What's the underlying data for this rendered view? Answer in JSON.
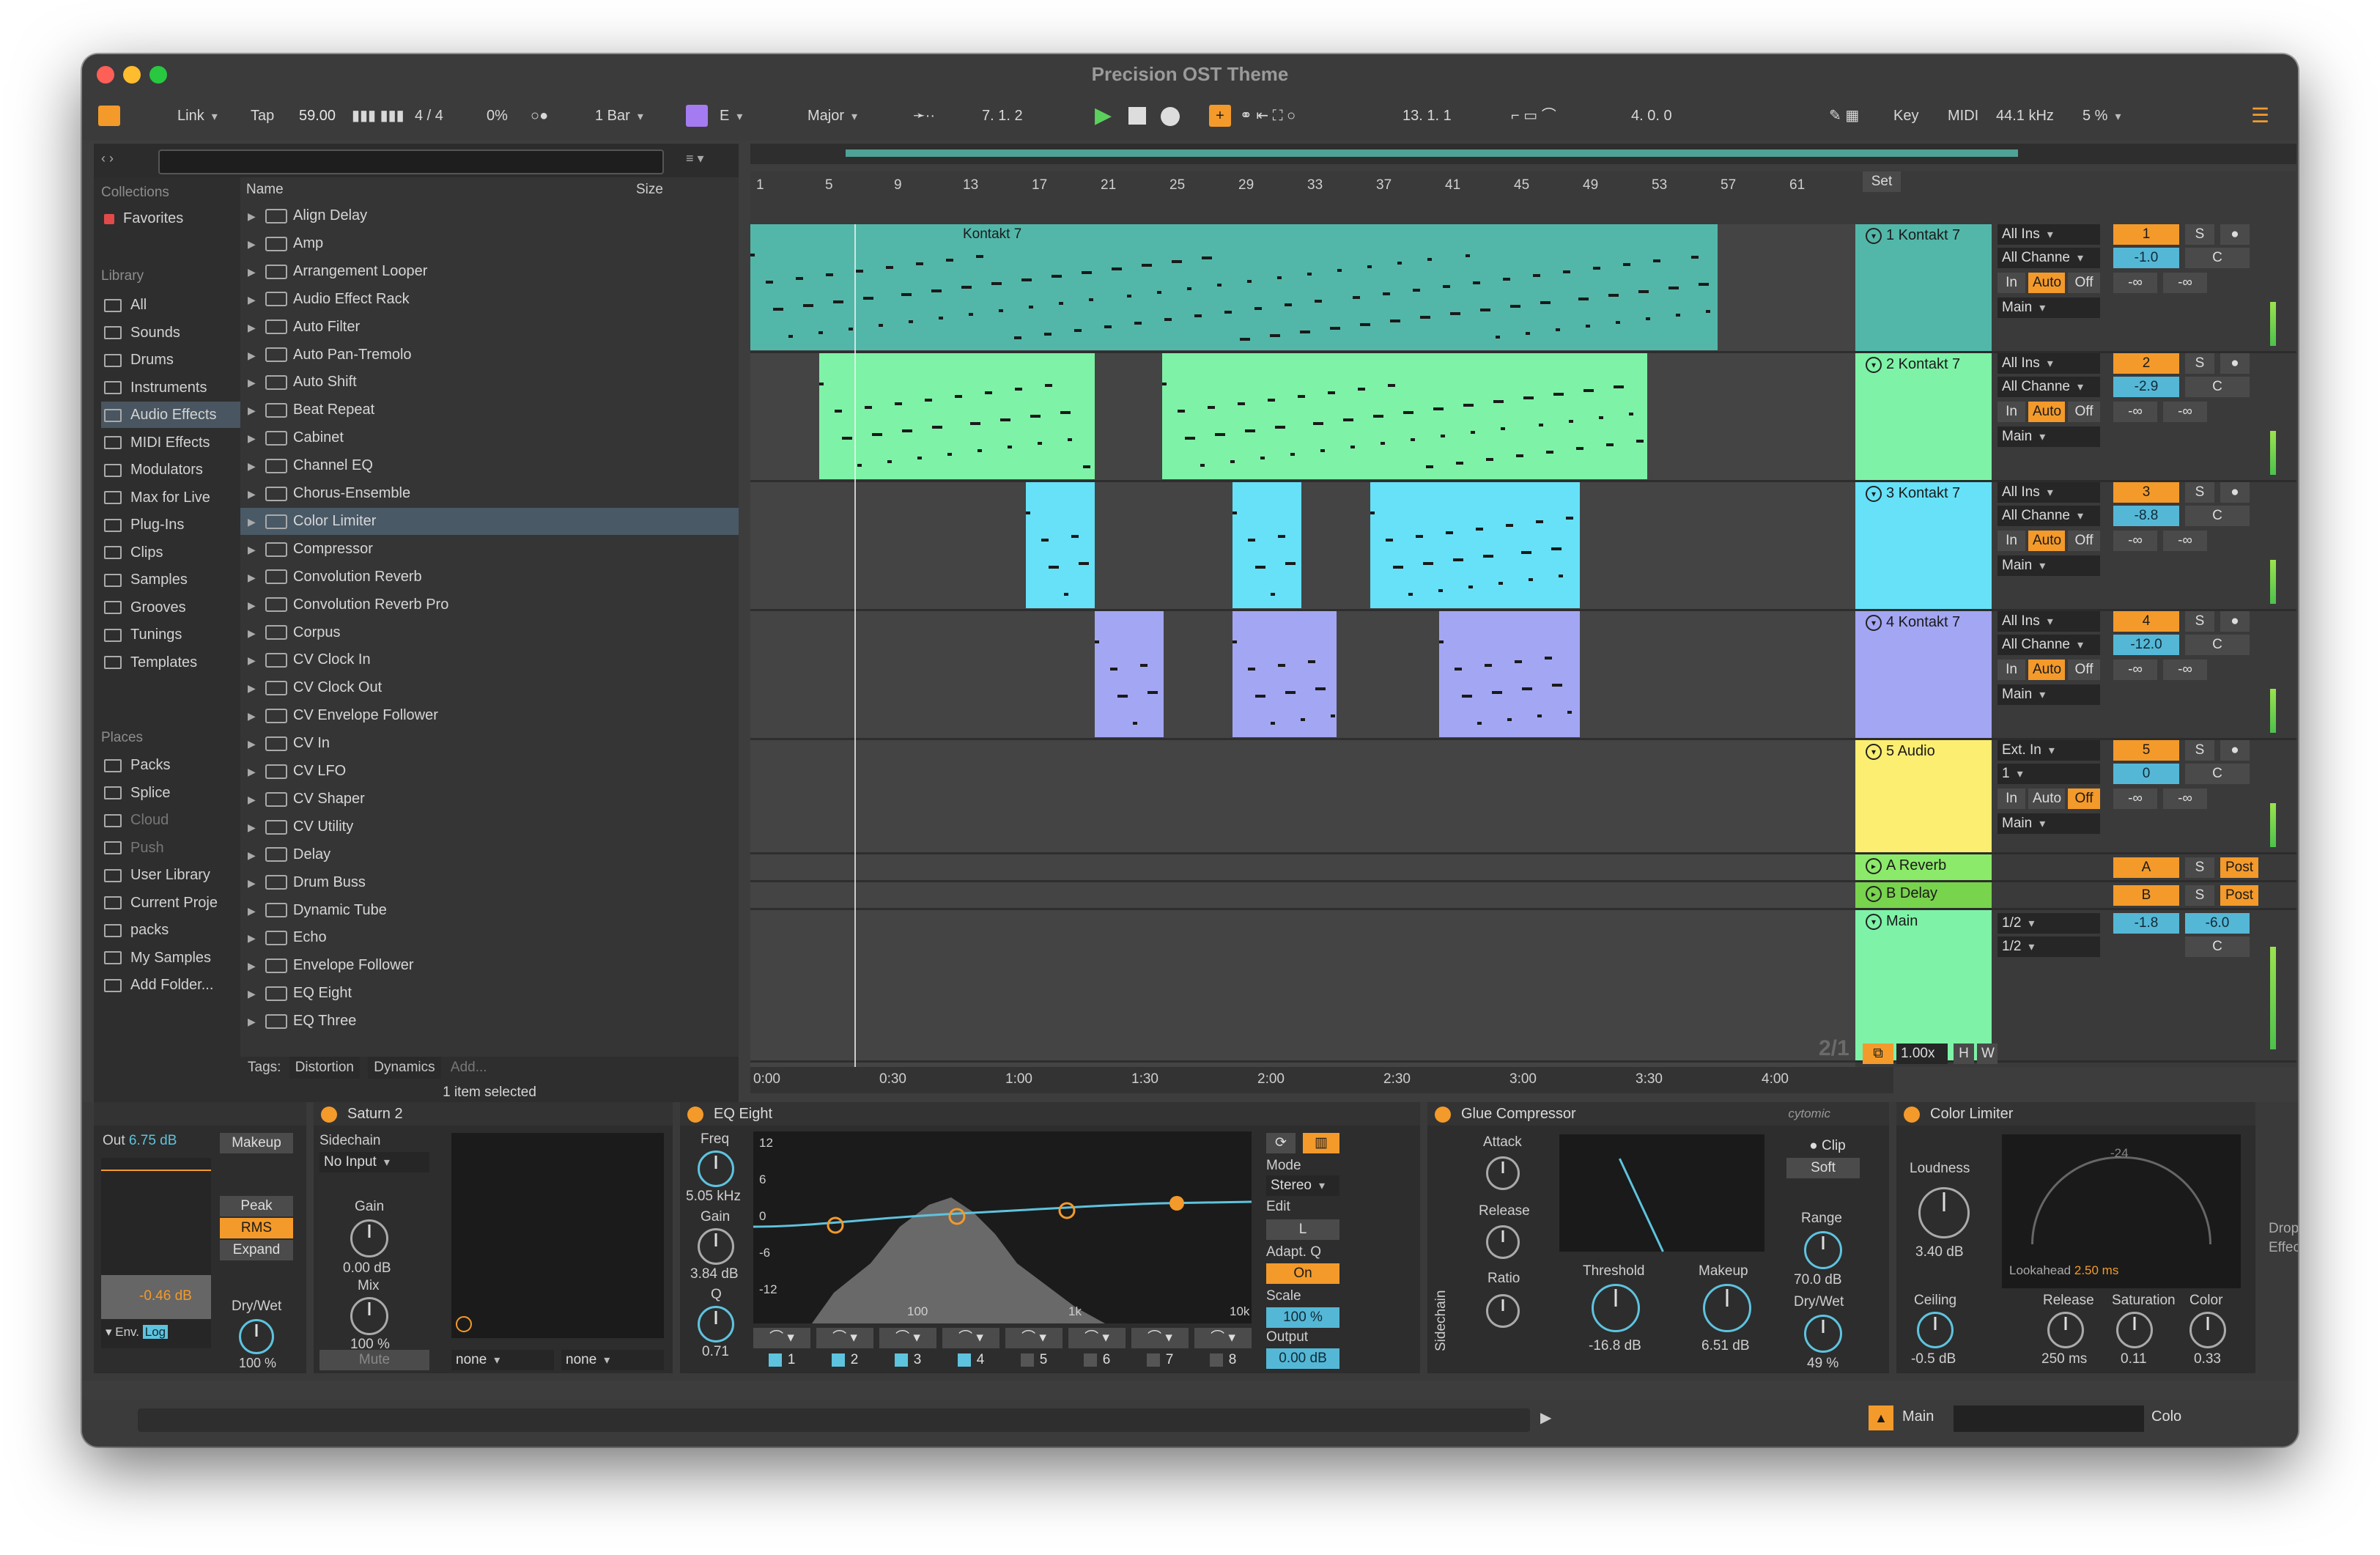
{
  "window": {
    "title": "Precision OST Theme"
  },
  "control_bar": {
    "link": "Link",
    "tap": "Tap",
    "tempo": "59.00",
    "signature": "4 / 4",
    "groove": "0%",
    "quantize": "1 Bar",
    "key_root": "E",
    "key_scale": "Major",
    "position": "7.  1.  2",
    "loop_start": "13.  1.  1",
    "loop_length": "4.  0.  0",
    "key_label": "Key",
    "midi_label": "MIDI",
    "sample_rate": "44.1 kHz",
    "cpu": "5 %"
  },
  "browser": {
    "collections_label": "Collections",
    "favorites": "Favorites",
    "library_label": "Library",
    "library": [
      "All",
      "Sounds",
      "Drums",
      "Instruments",
      "Audio Effects",
      "MIDI Effects",
      "Modulators",
      "Max for Live",
      "Plug-Ins",
      "Clips",
      "Samples",
      "Grooves",
      "Tunings",
      "Templates"
    ],
    "selected_library": "Audio Effects",
    "places_label": "Places",
    "places": [
      "Packs",
      "Splice",
      "Cloud",
      "Push",
      "User Library",
      "Current Proje",
      "packs",
      "My Samples",
      "Add Folder..."
    ],
    "col_name": "Name",
    "col_size": "Size",
    "files": [
      "Align Delay",
      "Amp",
      "Arrangement Looper",
      "Audio Effect Rack",
      "Auto Filter",
      "Auto Pan-Tremolo",
      "Auto Shift",
      "Beat Repeat",
      "Cabinet",
      "Channel EQ",
      "Chorus-Ensemble",
      "Color Limiter",
      "Compressor",
      "Convolution Reverb",
      "Convolution Reverb Pro",
      "Corpus",
      "CV Clock In",
      "CV Clock Out",
      "CV Envelope Follower",
      "CV In",
      "CV LFO",
      "CV Shaper",
      "CV Utility",
      "Delay",
      "Drum Buss",
      "Dynamic Tube",
      "Echo",
      "Envelope Follower",
      "EQ Eight",
      "EQ Three"
    ],
    "selected_file": "Color Limiter",
    "tags_label": "Tags:",
    "tags": [
      "Distortion",
      "Dynamics"
    ],
    "tags_add": "Add...",
    "status": "1 item selected"
  },
  "arrangement": {
    "bars": [
      "1",
      "5",
      "9",
      "13",
      "17",
      "21",
      "25",
      "29",
      "33",
      "37",
      "41",
      "45",
      "49",
      "53",
      "57",
      "61"
    ],
    "times": [
      "0:00",
      "0:30",
      "1:00",
      "1:30",
      "2:00",
      "2:30",
      "3:00",
      "3:30",
      "4:00"
    ],
    "page": "2/1",
    "clip_label": "Kontakt 7",
    "zoom": "1.00x",
    "h_btn": "H",
    "w_btn": "W",
    "set_btn": "Set"
  },
  "tracks": [
    {
      "name": "1 Kontakt 7",
      "color": "#52b7a9",
      "input": "All Ins",
      "channel": "All Channe",
      "num": "1",
      "vol": "-1.0",
      "pan": "C",
      "out": "Main"
    },
    {
      "name": "2 Kontakt 7",
      "color": "#7ef2a7",
      "input": "All Ins",
      "channel": "All Channe",
      "num": "2",
      "vol": "-2.9",
      "pan": "C",
      "out": "Main"
    },
    {
      "name": "3 Kontakt 7",
      "color": "#66e1f8",
      "input": "All Ins",
      "channel": "All Channe",
      "num": "3",
      "vol": "-8.8",
      "pan": "C",
      "out": "Main"
    },
    {
      "name": "4 Kontakt 7",
      "color": "#a3a6f2",
      "input": "All Ins",
      "channel": "All Channe",
      "num": "4",
      "vol": "-12.0",
      "pan": "C",
      "out": "Main"
    },
    {
      "name": "5 Audio",
      "color": "#fbee71",
      "input": "Ext. In",
      "channel": "1",
      "num": "5",
      "vol": "0",
      "pan": "C",
      "out": "Main"
    }
  ],
  "returns": [
    {
      "name": "A Reverb",
      "color": "#8cea6a",
      "num": "A",
      "post": "Post"
    },
    {
      "name": "B Delay",
      "color": "#78d34d",
      "num": "B",
      "post": "Post"
    }
  ],
  "main": {
    "name": "Main",
    "color": "#7ef2a7",
    "in1": "1/2",
    "in2": "1/2",
    "vol": "-1.8",
    "vol2": "-6.0",
    "pan": "C"
  },
  "mixer_labels": {
    "in": "In",
    "auto": "Auto",
    "off": "Off",
    "solo": "S",
    "neg_inf": "-∞"
  },
  "devices": {
    "utility": {
      "out": "Out",
      "out_val": "6.75 dB",
      "makeup": "Makeup",
      "peak": "Peak",
      "rms": "RMS",
      "expand": "Expand",
      "level": "-0.46 dB",
      "drywet_label": "Dry/Wet",
      "drywet": "100 %",
      "env": "Env.",
      "log": "Log"
    },
    "saturn": {
      "title": "Saturn 2",
      "sidechain": "Sidechain",
      "input": "No Input",
      "gain_label": "Gain",
      "gain": "0.00 dB",
      "mix_label": "Mix",
      "mix": "100 %",
      "mute": "Mute",
      "sel1": "none",
      "sel2": "none"
    },
    "eq8": {
      "title": "EQ Eight",
      "freq_label": "Freq",
      "freq": "5.05 kHz",
      "gain_label": "Gain",
      "gain": "3.84 dB",
      "q_label": "Q",
      "q": "0.71",
      "mode_label": "Mode",
      "mode": "Stereo",
      "edit_label": "Edit",
      "edit": "L",
      "adapt_label": "Adapt. Q",
      "adapt": "On",
      "scale_label": "Scale",
      "scale": "100 %",
      "output_label": "Output",
      "output": "0.00 dB",
      "db_ticks": [
        "12",
        "6",
        "0",
        "-6",
        "-12"
      ],
      "freq_ticks": [
        "100",
        "1k",
        "10k"
      ],
      "bands": [
        "1",
        "2",
        "3",
        "4",
        "5",
        "6",
        "7",
        "8"
      ]
    },
    "glue": {
      "title": "Glue Compressor",
      "brand": "cytomic",
      "attack_label": "Attack",
      "release_label": "Release",
      "ratio_label": "Ratio",
      "clip_label": "Clip",
      "soft": "Soft",
      "threshold_label": "Threshold",
      "threshold": "-16.8 dB",
      "makeup_label": "Makeup",
      "makeup": "6.51 dB",
      "range_label": "Range",
      "range": "70.0 dB",
      "drywet_label": "Dry/Wet",
      "drywet": "49 %",
      "sidechain": "Sidechain"
    },
    "color_limiter": {
      "title": "Color Limiter",
      "loudness_label": "Loudness",
      "loudness": "3.40 dB",
      "lookahead_label": "Lookahead",
      "lookahead": "2.50 ms",
      "ceiling_label": "Ceiling",
      "ceiling": "-0.5 dB",
      "release_label": "Release",
      "release": "250 ms",
      "saturation_label": "Saturation",
      "saturation": "0.11",
      "color_label": "Color",
      "color": "0.33",
      "meter_tick": "-24"
    },
    "drop_hint": "Drop Effects"
  },
  "status_bar": {
    "main": "Main",
    "color": "Colo"
  },
  "colors": {
    "accent": "#f39a2b",
    "blue": "#55b7d6",
    "bg": "#3d3d3d"
  }
}
